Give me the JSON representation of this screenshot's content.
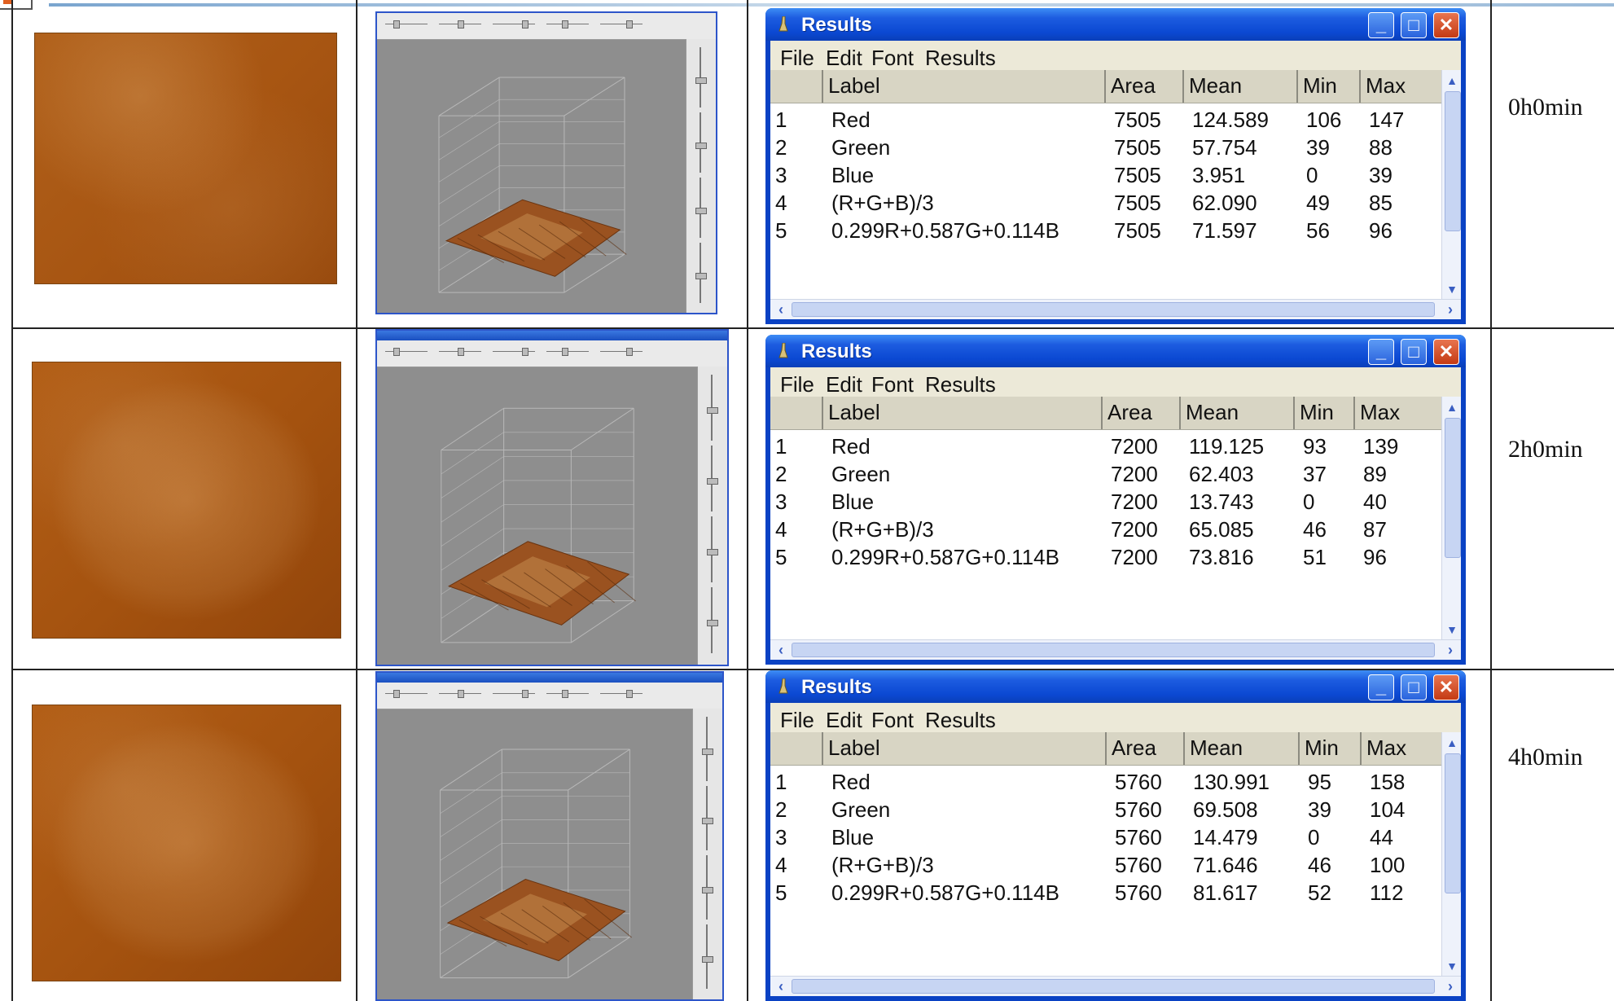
{
  "columns": [
    "Label",
    "Area",
    "Mean",
    "Min",
    "Max"
  ],
  "menu": [
    "File",
    "Edit",
    "Font",
    "Results"
  ],
  "window_title": "Results",
  "rows": [
    {
      "time": "0h0min",
      "results": [
        [
          "1",
          "Red",
          "7505",
          "124.589",
          "106",
          "147"
        ],
        [
          "2",
          "Green",
          "7505",
          "57.754",
          "39",
          "88"
        ],
        [
          "3",
          "Blue",
          "7505",
          "3.951",
          "0",
          "39"
        ],
        [
          "4",
          "(R+G+B)/3",
          "7505",
          "62.090",
          "49",
          "85"
        ],
        [
          "5",
          "0.299R+0.587G+0.114B",
          "7505",
          "71.597",
          "56",
          "96"
        ]
      ]
    },
    {
      "time": "2h0min",
      "results": [
        [
          "1",
          "Red",
          "7200",
          "119.125",
          "93",
          "139"
        ],
        [
          "2",
          "Green",
          "7200",
          "62.403",
          "37",
          "89"
        ],
        [
          "3",
          "Blue",
          "7200",
          "13.743",
          "0",
          "40"
        ],
        [
          "4",
          "(R+G+B)/3",
          "7200",
          "65.085",
          "46",
          "87"
        ],
        [
          "5",
          "0.299R+0.587G+0.114B",
          "7200",
          "73.816",
          "51",
          "96"
        ]
      ]
    },
    {
      "time": "4h0min",
      "results": [
        [
          "1",
          "Red",
          "5760",
          "130.991",
          "95",
          "158"
        ],
        [
          "2",
          "Green",
          "5760",
          "69.508",
          "39",
          "104"
        ],
        [
          "3",
          "Blue",
          "5760",
          "14.479",
          "0",
          "44"
        ],
        [
          "4",
          "(R+G+B)/3",
          "5760",
          "71.646",
          "46",
          "100"
        ],
        [
          "5",
          "0.299R+0.587G+0.114B",
          "5760",
          "81.617",
          "52",
          "112"
        ]
      ]
    }
  ],
  "icons": {
    "app": "imagej-microscope-icon",
    "minimize": "minimize-icon",
    "maximize": "maximize-icon",
    "close": "close-icon"
  },
  "colors": {
    "titlebar": "#0b48d2",
    "close_button": "#d9522b",
    "window_body": "#ece9d8",
    "sample_brown": "#a4520f",
    "plot_background": "#8e8e8e"
  }
}
